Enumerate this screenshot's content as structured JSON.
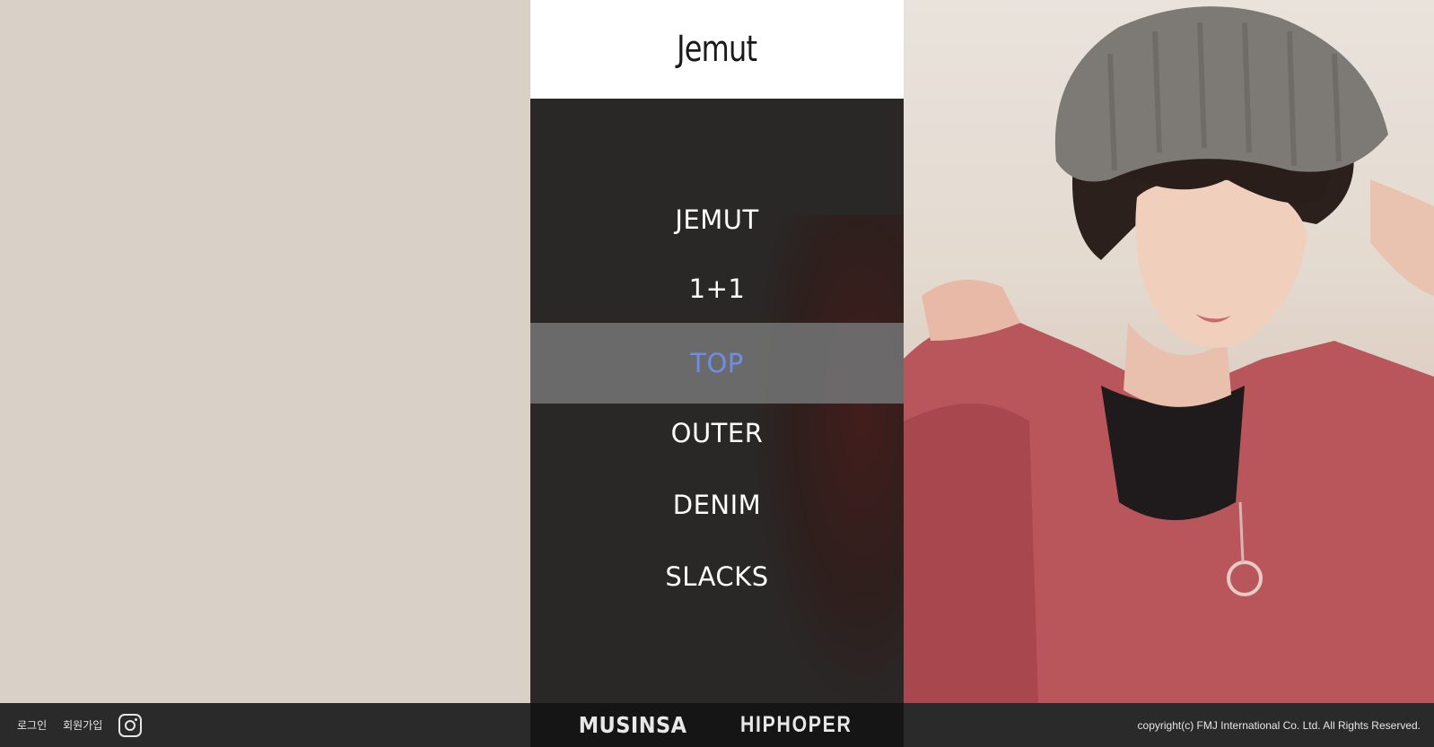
{
  "header": {
    "logo_text": "Jemut"
  },
  "menu": {
    "items": [
      {
        "label": "JEMUT"
      },
      {
        "label": "1+1"
      },
      {
        "label": "TOP"
      },
      {
        "label": "OUTER"
      },
      {
        "label": "DENIM"
      },
      {
        "label": "SLACKS"
      }
    ],
    "active_index": 2
  },
  "footer": {
    "login_label": "로그인",
    "join_label": "회원가입",
    "instagram_icon": "instagram-icon",
    "brands": [
      "MUSINSA",
      "HIPHOPER"
    ],
    "copyright": "copyright(c) FMJ International Co. Ltd. All Rights Reserved."
  },
  "colors": {
    "beige": "#d9d0c7",
    "menu_bg": "#292827",
    "active_bg": "#6e6e6e",
    "active_text": "#6f8ce6",
    "footer_bg": "#2a2a2a"
  }
}
